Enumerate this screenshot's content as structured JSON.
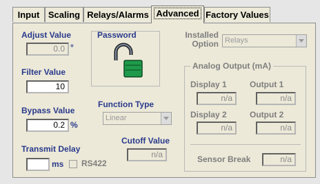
{
  "tabs": [
    {
      "label": "Input"
    },
    {
      "label": "Scaling"
    },
    {
      "label": "Relays/Alarms"
    },
    {
      "label": "Advanced"
    },
    {
      "label": "Factory Values"
    }
  ],
  "advanced": {
    "adjust_value": {
      "label": "Adjust Value",
      "value": "0.0",
      "unit": "°"
    },
    "filter_value": {
      "label": "Filter Value",
      "value": "10"
    },
    "bypass_value": {
      "label": "Bypass Value",
      "value": "0.2",
      "unit": "%"
    },
    "transmit_delay": {
      "label": "Transmit Delay",
      "value": "",
      "unit": "ms",
      "rs422_label": "RS422"
    },
    "password": {
      "title": "Password"
    },
    "function_type": {
      "label": "Function Type",
      "value": "Linear"
    },
    "cutoff_value": {
      "label": "Cutoff Value",
      "value": "n/a"
    },
    "installed_option": {
      "label_line1": "Installed",
      "label_line2": "Option",
      "value": "Relays"
    },
    "analog_output": {
      "title": "Analog Output (mA)",
      "display1": {
        "label": "Display 1",
        "value": "n/a"
      },
      "output1": {
        "label": "Output 1",
        "value": "n/a"
      },
      "display2": {
        "label": "Display 2",
        "value": "n/a"
      },
      "output2": {
        "label": "Output 2",
        "value": "n/a"
      },
      "sensor_break": {
        "label": "Sensor Break",
        "value": "n/a"
      }
    }
  },
  "colors": {
    "label_blue": "#2a3a8c",
    "lock_green": "#1f9a4a"
  }
}
